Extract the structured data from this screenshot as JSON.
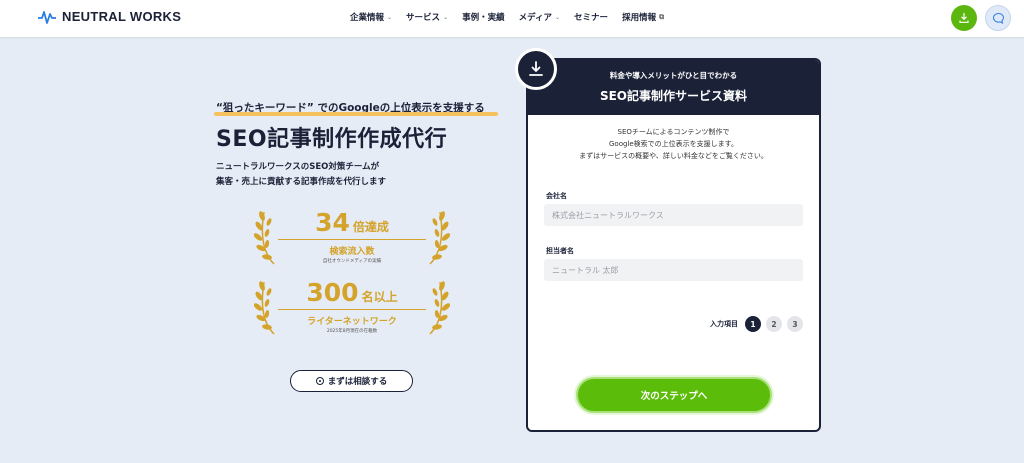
{
  "header": {
    "logo_text": "NEUTRAL WORKS",
    "nav": [
      {
        "label": "企業情報",
        "has_dropdown": true
      },
      {
        "label": "サービス",
        "has_dropdown": true
      },
      {
        "label": "事例・実績",
        "has_dropdown": false
      },
      {
        "label": "メディア",
        "has_dropdown": true
      },
      {
        "label": "セミナー",
        "has_dropdown": false
      },
      {
        "label": "採用情報",
        "external": true
      }
    ],
    "download_icon": "download-icon",
    "chat_icon": "chat-bubble-icon"
  },
  "hero": {
    "tagline": "“狙ったキーワード” でのGoogleの上位表示を支援する",
    "title": "SEO記事制作作成代行",
    "desc_line1": "ニュートラルワークスのSEO対策チームが",
    "desc_line2": "集客・売上に貢献する記事作成を代行します",
    "awards": [
      {
        "number": "34",
        "unit": "倍達成",
        "label": "検索流入数",
        "sub": "自社オウンドメディアの実績"
      },
      {
        "number": "300",
        "unit": "名以上",
        "label": "ライターネットワーク",
        "sub": "2025年8月現在の在籍数"
      }
    ],
    "consult_label": "まずは相談する"
  },
  "form_card": {
    "subtitle": "料金や導入メリットがひと目でわかる",
    "title": "SEO記事制作サービス資料",
    "intro_line1": "SEOチームによるコンテンツ制作で",
    "intro_line2": "Google検索での上位表示を支援します。",
    "intro_line3": "まずはサービスの概要や、詳しい料金などをご覧ください。",
    "company_label": "会社名",
    "company_placeholder": "株式会社ニュートラルワークス",
    "person_label": "担当者名",
    "person_placeholder": "ニュートラル 太郎",
    "steps_label": "入力項目",
    "steps": [
      "1",
      "2",
      "3"
    ],
    "current_step": 1,
    "next_label": "次のステップへ"
  },
  "colors": {
    "navy": "#1b2238",
    "green": "#5bbd0a",
    "gold": "#d4a32b",
    "background": "#e6ecf5"
  }
}
